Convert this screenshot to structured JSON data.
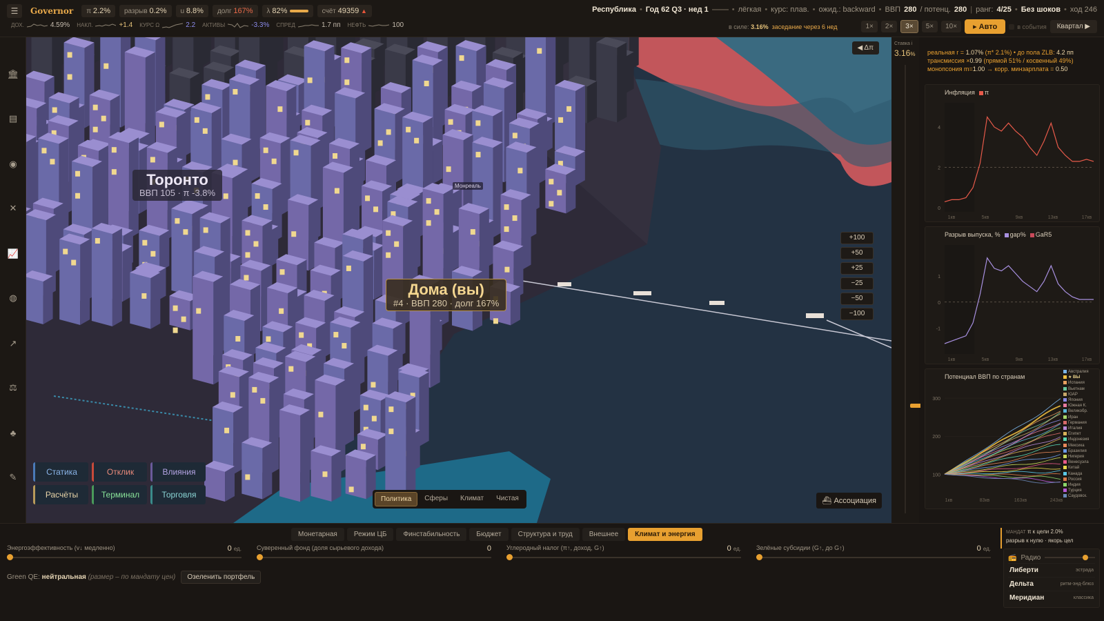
{
  "topbar": {
    "menu_icon": "menu-icon",
    "brand": "Governor",
    "chips": [
      {
        "label": "π",
        "value": "2.2%"
      },
      {
        "label": "разрыв",
        "value": "0.2%"
      },
      {
        "label": "u",
        "value": "8.8%"
      },
      {
        "label": "долг",
        "value": "167%"
      },
      {
        "label": "λ",
        "value": "82%"
      },
      {
        "label": "счёт",
        "value": "49359"
      }
    ],
    "lambda_level": 0.82,
    "country": "Республика",
    "date": "Год 62 Q3 · нед 1",
    "mode": "лёгкая",
    "fx": "курс: плав.",
    "expect": "ожид.: backward",
    "gdp_label": "ВВП",
    "gdp": "280",
    "potential_label": "/ потенц.",
    "potential": "280",
    "rank_label": "ранг:",
    "rank": "4/25",
    "shocks": "Без шоков",
    "turn": "ход 246",
    "sparks": [
      {
        "label": "ДОХ.",
        "value": "4.59%"
      },
      {
        "label": "НАКЛ.",
        "value": "+1.4"
      },
      {
        "label": "КУРС Ω",
        "value": "2.2"
      },
      {
        "label": "АКТИВЫ",
        "value": "-3.3%"
      },
      {
        "label": "СПРЕД",
        "value": "1.7 пп"
      },
      {
        "label": "НЕФТЬ",
        "value": "100"
      }
    ],
    "in_force_label": "в силе:",
    "in_force": "3.16%",
    "meeting": "заседание через 6 нед",
    "speeds": [
      "1×",
      "2×",
      "3×",
      "5×",
      "10×"
    ],
    "auto": "▸ Авто",
    "events": "в события",
    "quarter": "Квартал ▶"
  },
  "sidebar_icons": [
    "bank-icon",
    "budget-icon",
    "coins-icon",
    "tools-icon",
    "chart-icon",
    "globe-icon",
    "trend-icon",
    "scales-icon",
    "plant-icon",
    "report-icon"
  ],
  "map": {
    "toronto": {
      "name": "Торонто",
      "sub": "ВВП 105 · π -3.8%"
    },
    "home": {
      "name": "Дома (вы)",
      "sub": "#4 · ВВП 280 · долг 167%"
    },
    "montreal": "Монреаль",
    "delta_btn": "◀ Δπ",
    "nudges": [
      "+100",
      "+50",
      "+25",
      "−25",
      "−50",
      "−100"
    ],
    "layers": [
      {
        "label": "Статика",
        "color": "#4a7ab8",
        "text": "#8ab4e8"
      },
      {
        "label": "Отклик",
        "color": "#c84a3a",
        "text": "#e88a7a"
      },
      {
        "label": "Влияния",
        "color": "#6a5a9a",
        "text": "#b4a4e4"
      },
      {
        "label": "Расчёты",
        "color": "#b89a5a",
        "text": "#e8d4a8"
      },
      {
        "label": "Терминал",
        "color": "#4a9a5a",
        "text": "#8ae49a"
      },
      {
        "label": "Торговля",
        "color": "#3a8a8a",
        "text": "#8ad4d4"
      }
    ],
    "tabs": [
      "Политика",
      "Сферы",
      "Климат",
      "Чистая"
    ],
    "assoc": "Ассоциация"
  },
  "rate": {
    "label": "Ставка i",
    "value": "3.16",
    "unit": "%",
    "level": 0.24
  },
  "info": {
    "line1_a": "реальная r = ",
    "line1_b": "1.07%",
    "line1_c": " (π* 2.1%) • до пола ZLB: ",
    "line1_d": "4.2 пп",
    "line2_a": "трансмиссия ×",
    "line2_b": "0.99",
    "line2_c": " (прямой 51% / косвенный 49%)",
    "line3_a": "монопсония m=",
    "line3_b": "1.00",
    "line3_c": " → корр. минзарплата = ",
    "line3_d": "0.50"
  },
  "chart_data": [
    {
      "type": "line",
      "title": "Инфляция",
      "series": [
        {
          "name": "π",
          "color": "#e85a4a",
          "x": [
            0,
            1,
            2,
            3,
            4,
            5,
            6,
            7,
            8,
            9,
            10,
            11,
            12,
            13,
            14,
            15,
            16,
            17,
            18,
            19,
            20,
            21
          ],
          "values": [
            0.3,
            0.4,
            0.4,
            0.5,
            1.0,
            2.2,
            4.5,
            4.0,
            3.8,
            4.2,
            3.8,
            3.5,
            3.0,
            2.6,
            3.3,
            4.2,
            3.0,
            2.6,
            2.3,
            2.3,
            2.4,
            2.3
          ]
        }
      ],
      "reference": 2.0,
      "ylim": [
        -0.2,
        5.2
      ],
      "yticks": [
        0,
        2,
        4
      ],
      "xticks": [
        "1кв",
        "5кв",
        "9кв",
        "13кв",
        "17кв"
      ]
    },
    {
      "type": "line",
      "title": "Разрыв выпуска, %",
      "series": [
        {
          "name": "gap%",
          "color": "#a890e0",
          "x": [
            0,
            1,
            2,
            3,
            4,
            5,
            6,
            7,
            8,
            9,
            10,
            11,
            12,
            13,
            14,
            15,
            16,
            17,
            18,
            19,
            20,
            21
          ],
          "values": [
            -1.6,
            -1.5,
            -1.4,
            -1.3,
            -0.8,
            0.3,
            1.7,
            1.3,
            1.2,
            1.4,
            1.1,
            0.8,
            0.6,
            0.4,
            0.8,
            1.4,
            0.7,
            0.4,
            0.2,
            0.1,
            0.1,
            0.1
          ]
        },
        {
          "name": "GaR5",
          "color": "#c84a5a",
          "values": []
        }
      ],
      "reference": 0,
      "ylim": [
        -2,
        2.2
      ],
      "yticks": [
        -1,
        0,
        1
      ],
      "xticks": [
        "1кв",
        "5кв",
        "9кв",
        "13кв",
        "17кв"
      ]
    },
    {
      "type": "line",
      "title": "Потенциал ВВП по странам",
      "x": [
        1,
        243
      ],
      "ylim": [
        50,
        340
      ],
      "yticks": [
        100,
        200,
        300
      ],
      "xticks": [
        "1кв",
        "83кв",
        "163кв",
        "243кв"
      ],
      "series": [
        {
          "name": "Австралия",
          "color": "#7ab4e8",
          "values": [
            100,
            295
          ]
        },
        {
          "name": "★ ВЫ",
          "color": "#f0c040",
          "values": [
            100,
            280
          ]
        },
        {
          "name": "Испания",
          "color": "#e8a060",
          "values": [
            100,
            270
          ]
        },
        {
          "name": "Вьетнам",
          "color": "#6ac8a0",
          "values": [
            100,
            262
          ]
        },
        {
          "name": "ЮАР",
          "color": "#c8a86a",
          "values": [
            100,
            255
          ]
        },
        {
          "name": "Япония",
          "color": "#8a8ae8",
          "values": [
            100,
            245
          ]
        },
        {
          "name": "Южная К.",
          "color": "#e87aa0",
          "values": [
            100,
            238
          ]
        },
        {
          "name": "Великобр.",
          "color": "#5ab8d8",
          "values": [
            100,
            230
          ]
        },
        {
          "name": "Иран",
          "color": "#a8d86a",
          "values": [
            100,
            220
          ]
        },
        {
          "name": "Германия",
          "color": "#d86a6a",
          "values": [
            100,
            212
          ]
        },
        {
          "name": "Италия",
          "color": "#b88ad8",
          "values": [
            100,
            200
          ]
        },
        {
          "name": "Египет",
          "color": "#d8b45a",
          "values": [
            100,
            190
          ]
        },
        {
          "name": "Индонезия",
          "color": "#5ad8b4",
          "values": [
            100,
            178
          ]
        },
        {
          "name": "Мексика",
          "color": "#e8885a",
          "values": [
            100,
            165
          ]
        },
        {
          "name": "Бразилия",
          "color": "#6a9ae8",
          "values": [
            100,
            152
          ]
        },
        {
          "name": "Нигерия",
          "color": "#c8d85a",
          "values": [
            100,
            140
          ]
        },
        {
          "name": "Венесуэла",
          "color": "#e85a8a",
          "values": [
            100,
            128
          ]
        },
        {
          "name": "Китай",
          "color": "#e8d84a",
          "values": [
            100,
            118
          ]
        },
        {
          "name": "Канада",
          "color": "#5ac8e8",
          "values": [
            100,
            108
          ]
        },
        {
          "name": "Россия",
          "color": "#d87a4a",
          "values": [
            100,
            98
          ]
        },
        {
          "name": "Индия",
          "color": "#8ad86a",
          "values": [
            100,
            90
          ]
        },
        {
          "name": "Турция",
          "color": "#b85ad8",
          "values": [
            100,
            82
          ]
        },
        {
          "name": "Саудовск.",
          "color": "#6a8ab8",
          "values": [
            100,
            76
          ]
        }
      ]
    }
  ],
  "bottom": {
    "tabs": [
      "Монетарная",
      "Режим ЦБ",
      "Финстабильность",
      "Бюджет",
      "Структура и труд",
      "Внешнее",
      "Климат и энергия"
    ],
    "sliders": [
      {
        "label": "Энергоэффективность (v↓ медленно)",
        "value": "0",
        "unit": "ед."
      },
      {
        "label": "Суверенный фонд (доля сырьевого дохода)",
        "value": "0",
        "unit": ""
      },
      {
        "label": "Углеродный налог (π↑, доход, G↑)",
        "value": "0",
        "unit": "ед."
      },
      {
        "label": "Зелёные субсидии (G↑, до G↑)",
        "value": "0",
        "unit": "ед."
      }
    ],
    "greenqe_label": "Green QE:",
    "greenqe_value": "нейтральная",
    "greenqe_note": "(размер – по мандату цен)",
    "greenqe_btn": "Озеленить портфель",
    "mandate_label": "МАНДАТ",
    "mandate_line1": "π к цели 2.0%",
    "mandate_line2": "разрыв к нулю · якорь цел",
    "radio_label": "Радио",
    "radio_volume": 0.85,
    "stations": [
      {
        "name": "Либерти",
        "genre": "эстрада"
      },
      {
        "name": "Дельта",
        "genre": "ритм-энд-блюз"
      },
      {
        "name": "Меридиан",
        "genre": "классика"
      }
    ]
  }
}
